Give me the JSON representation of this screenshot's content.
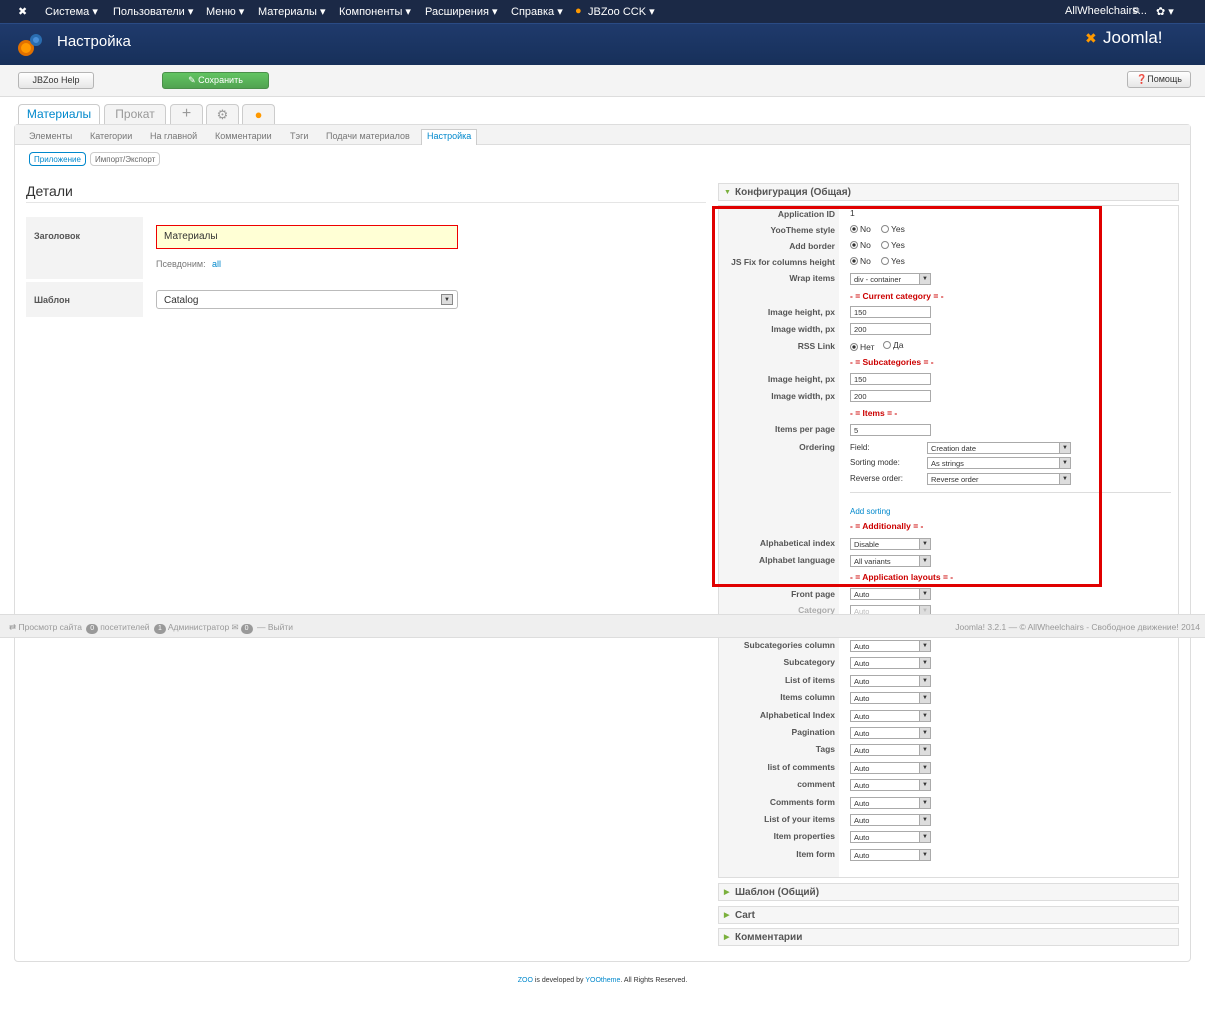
{
  "navbar": {
    "menu": [
      "Система ▾",
      "Пользователи ▾",
      "Меню ▾",
      "Материалы ▾",
      "Компоненты ▾",
      "Расширения ▾",
      "Справка ▾",
      "JBZoo CCK ▾"
    ],
    "site_name": "AllWheelchairs...",
    "gear": "✿ ▾"
  },
  "header": {
    "title": "Настройка",
    "logo_text": "Joomla!"
  },
  "toolbar": {
    "help_label": "JBZoo Help",
    "save_label": "Сохранить",
    "help_right_label": "Помощь"
  },
  "app_tabs": [
    "Материалы",
    "Прокат"
  ],
  "sub_tabs": [
    "Элементы",
    "Категории",
    "На главной",
    "Комментарии",
    "Тэги",
    "Подачи материалов",
    "Настройка"
  ],
  "pills": [
    "Приложение",
    "Импорт/Экспорт"
  ],
  "details": {
    "heading": "Детали",
    "title_label": "Заголовок",
    "title_value": "Материалы",
    "alias_label": "Псевдоним:",
    "alias_value": "all",
    "template_label": "Шаблон",
    "template_value": "Catalog"
  },
  "config": {
    "header": "Конфигурация (Общая)",
    "app_id_label": "Application ID",
    "app_id_value": "1",
    "yootheme_label": "YooTheme style",
    "border_label": "Add border",
    "jsfix_label": "JS Fix for columns height",
    "no": "No",
    "yes": "Yes",
    "wrap_label": "Wrap items",
    "wrap_value": "div - container",
    "sec_current": "- = Current category = -",
    "img_h_label": "Image height, px",
    "img_w_label": "Image width, px",
    "img_h_value": "150",
    "img_w_value": "200",
    "rss_label": "RSS Link",
    "rss_no": "Нет",
    "rss_yes": "Да",
    "sec_sub": "- = Subcategories = -",
    "sub_img_h_value": "150",
    "sub_img_w_value": "200",
    "sec_items": "- = Items = -",
    "per_page_label": "Items per page",
    "per_page_value": "5",
    "ordering_label": "Ordering",
    "field_label": "Field:",
    "field_value": "Creation date",
    "sort_label": "Sorting mode:",
    "sort_value": "As strings",
    "reverse_label": "Reverse order:",
    "reverse_value": "Reverse order",
    "add_sorting": "Add sorting",
    "sec_add": "- = Additionally = -",
    "alpha_label": "Alphabetical index",
    "alpha_value": "Disable",
    "alpha_lang_label": "Alphabet language",
    "alpha_lang_value": "All variants",
    "sec_layouts": "- = Application layouts = -",
    "front_label": "Front page",
    "category_label": "Category",
    "auto": "Auto",
    "layouts": [
      "Subcategories column",
      "Subcategory",
      "List of items",
      "Items column",
      "Alphabetical Index",
      "Pagination",
      "Tags",
      "list of comments",
      "comment",
      "Comments form",
      "List of your items",
      "Item properties",
      "Item form"
    ]
  },
  "accordions": [
    "Шаблон (Общий)",
    "Cart",
    "Комментарии"
  ],
  "statusbar": {
    "view_site": "Просмотр сайта",
    "visitors_count": "0",
    "visitors": "посетителей",
    "admins_count": "1",
    "admins": "Администратор",
    "msgs_count": "0",
    "logout": "Выйти",
    "right": "Joomla! 3.2.1 — © AllWheelchairs - Свободное движение! 2014"
  },
  "footer": {
    "zoo": "ZOO",
    "is_dev": " is developed by ",
    "yoo": "YOOtheme",
    "rights": ". All Rights Reserved."
  },
  "colors": {
    "navbar": "#1b2946",
    "header": "#1f3a6c",
    "accent": "#0088cc",
    "highlight": "#e00000",
    "section": "#cc0000"
  }
}
